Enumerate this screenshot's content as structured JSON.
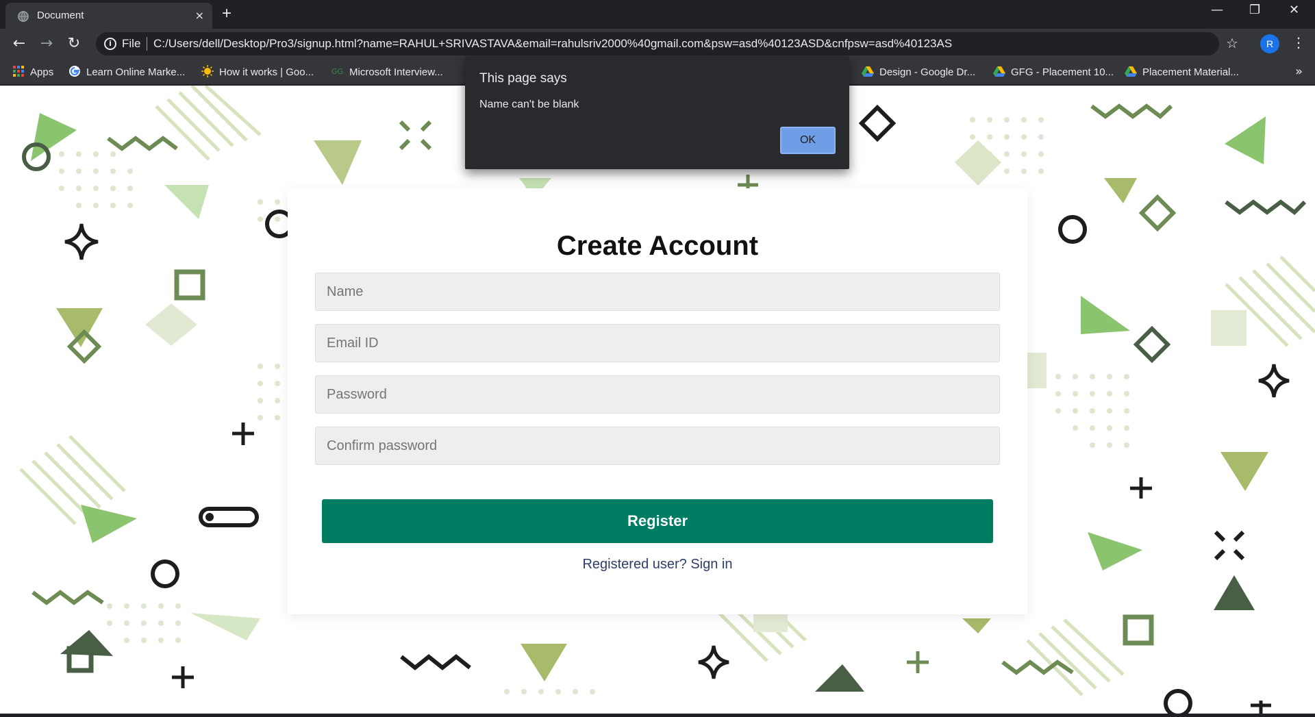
{
  "browser": {
    "tab_title": "Document",
    "tab_close": "×",
    "new_tab": "+",
    "window_controls": {
      "minimize": "—",
      "restore": "❐",
      "close": "✕"
    },
    "nav": {
      "back": "←",
      "forward": "→",
      "reload": "↻"
    },
    "omnibox": {
      "scheme_label": "File",
      "url": "C:/Users/dell/Desktop/Pro3/signup.html?name=RAHUL+SRIVASTAVA&email=rahulsriv2000%40gmail.com&psw=asd%40123ASD&cnfpsw=asd%40123AS"
    },
    "profile_initial": "R",
    "bookmarks": [
      {
        "label": "Apps",
        "icon": "apps-grid-icon"
      },
      {
        "label": "Learn Online Marke...",
        "icon": "google-icon"
      },
      {
        "label": "How it works | Goo...",
        "icon": "sun-icon"
      },
      {
        "label": "Microsoft Interview...",
        "icon": "gfg-icon"
      },
      {
        "label": "Design - Google Dr...",
        "icon": "google-drive-icon"
      },
      {
        "label": "GFG - Placement 10...",
        "icon": "google-drive-icon"
      },
      {
        "label": "Placement Material...",
        "icon": "google-drive-icon"
      }
    ],
    "bookmarks_overflow": "»"
  },
  "dialog": {
    "title": "This page says",
    "message": "Name can't be blank",
    "ok_label": "OK"
  },
  "form": {
    "title": "Create Account",
    "name_placeholder": "Name",
    "email_placeholder": "Email ID",
    "password_placeholder": "Password",
    "confirm_placeholder": "Confirm password",
    "register_label": "Register",
    "signin_text": "Registered user? Sign in"
  },
  "colors": {
    "accent": "#007c63",
    "decor_green_light": "#c8dbb0",
    "decor_green": "#8bc46e",
    "decor_olive": "#a7bb6a",
    "decor_dark": "#485e45"
  }
}
